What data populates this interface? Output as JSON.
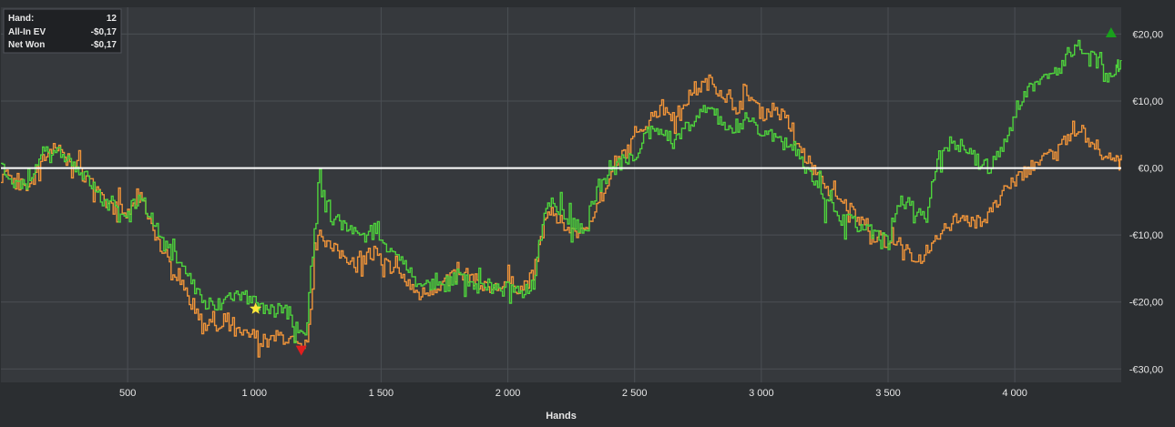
{
  "info_box": {
    "rows": [
      {
        "label": "Hand:",
        "value": "12"
      },
      {
        "label": "All-In EV",
        "value": "-$0,17"
      },
      {
        "label": "Net Won",
        "value": "-$0,17"
      }
    ]
  },
  "colors": {
    "background": "#2b2e31",
    "plot": "#36393d",
    "grid": "#4b4f54",
    "net_won": "#4ed33c",
    "all_in_ev": "#f09439",
    "zero_line": "#ffffff",
    "max_marker": "#19a01c",
    "min_marker": "#e01e1e",
    "star_marker": "#ffe83a"
  },
  "chart_data": {
    "type": "line",
    "xlabel": "Hands",
    "ylabel": "",
    "xlim": [
      0,
      4420
    ],
    "ylim": [
      -32,
      24
    ],
    "x_ticks": [
      500,
      1000,
      1500,
      2000,
      2500,
      3000,
      3500,
      4000
    ],
    "x_tick_labels": [
      "500",
      "1 000",
      "1 500",
      "2 000",
      "2 500",
      "3 000",
      "3 500",
      "4 000"
    ],
    "y_ticks": [
      20,
      10,
      0,
      -10,
      -20,
      -30
    ],
    "y_tick_labels": [
      "€20,00",
      "€10,00",
      "€0,00",
      "-€10,00",
      "-€20,00",
      "-€30,00"
    ],
    "grid": true,
    "series": [
      {
        "key": "net_won",
        "x": [
          0,
          50,
          100,
          150,
          200,
          250,
          300,
          350,
          400,
          450,
          500,
          550,
          600,
          650,
          700,
          750,
          800,
          850,
          900,
          950,
          1000,
          1050,
          1100,
          1150,
          1200,
          1250,
          1300,
          1350,
          1400,
          1450,
          1500,
          1550,
          1600,
          1650,
          1700,
          1750,
          1800,
          1850,
          1900,
          1950,
          2000,
          2050,
          2100,
          2150,
          2200,
          2250,
          2300,
          2350,
          2400,
          2450,
          2500,
          2550,
          2600,
          2650,
          2700,
          2750,
          2800,
          2850,
          2900,
          2950,
          3000,
          3050,
          3100,
          3150,
          3200,
          3250,
          3300,
          3350,
          3400,
          3450,
          3500,
          3550,
          3600,
          3650,
          3700,
          3750,
          3800,
          3850,
          3900,
          3950,
          4000,
          4050,
          4100,
          4150,
          4200,
          4250,
          4300,
          4350,
          4400
        ],
        "values": [
          0,
          -2,
          -3,
          1,
          3,
          2,
          0,
          -2,
          -5,
          -6,
          -7,
          -4,
          -8,
          -12,
          -13,
          -17,
          -20,
          -21,
          -19,
          -19,
          -20,
          -22,
          -21,
          -22,
          -26,
          -2,
          -7,
          -8,
          -10,
          -9,
          -11,
          -12,
          -15,
          -18,
          -17,
          -18,
          -16,
          -17,
          -17,
          -18,
          -18,
          -19,
          -17,
          -5,
          -6,
          -8,
          -9,
          -3,
          -1,
          1,
          2,
          5,
          6,
          4,
          6,
          8,
          9,
          7,
          5,
          8,
          5,
          6,
          4,
          2,
          -2,
          -5,
          -7,
          -8,
          -9,
          -10,
          -11,
          -5,
          -6,
          -7,
          2,
          4,
          3,
          1,
          0,
          3,
          8,
          12,
          13,
          14,
          16,
          18,
          17,
          14,
          15
        ],
        "end_value": 16
      },
      {
        "key": "all_in_ev",
        "x": [
          0,
          50,
          100,
          150,
          200,
          250,
          300,
          350,
          400,
          450,
          500,
          550,
          600,
          650,
          700,
          750,
          800,
          850,
          900,
          950,
          1000,
          1050,
          1100,
          1150,
          1200,
          1250,
          1300,
          1350,
          1400,
          1450,
          1500,
          1550,
          1600,
          1650,
          1700,
          1750,
          1800,
          1850,
          1900,
          1950,
          2000,
          2050,
          2100,
          2150,
          2200,
          2250,
          2300,
          2350,
          2400,
          2450,
          2500,
          2550,
          2600,
          2650,
          2700,
          2750,
          2800,
          2850,
          2900,
          2950,
          3000,
          3050,
          3100,
          3150,
          3200,
          3250,
          3300,
          3350,
          3400,
          3450,
          3500,
          3550,
          3600,
          3650,
          3700,
          3750,
          3800,
          3850,
          3900,
          3950,
          4000,
          4050,
          4100,
          4150,
          4200,
          4250,
          4300,
          4350,
          4400
        ],
        "values": [
          0,
          -2,
          -3,
          1,
          3,
          2,
          0,
          -2,
          -5,
          -6,
          -7,
          -4,
          -9,
          -14,
          -16,
          -20,
          -23,
          -24,
          -24,
          -25,
          -25,
          -26,
          -25,
          -26,
          -28,
          -9,
          -12,
          -13,
          -14,
          -13,
          -14,
          -15,
          -17,
          -19,
          -18,
          -17,
          -16,
          -16,
          -18,
          -18,
          -17,
          -18,
          -16,
          -7,
          -8,
          -9,
          -10,
          -5,
          -2,
          2,
          4,
          7,
          9,
          8,
          10,
          12,
          13,
          11,
          9,
          11,
          8,
          9,
          7,
          3,
          0,
          -3,
          -5,
          -6,
          -8,
          -10,
          -11,
          -12,
          -13,
          -14,
          -10,
          -8,
          -7,
          -8,
          -7,
          -4,
          -2,
          0,
          1,
          2,
          4,
          6,
          4,
          2,
          1
        ],
        "end_value": 2
      }
    ],
    "markers": [
      {
        "type": "max",
        "x": 4380,
        "y": 20.2
      },
      {
        "type": "min",
        "x": 1185,
        "y": -27.2
      },
      {
        "type": "star",
        "x": 1005,
        "y": -21
      }
    ]
  }
}
